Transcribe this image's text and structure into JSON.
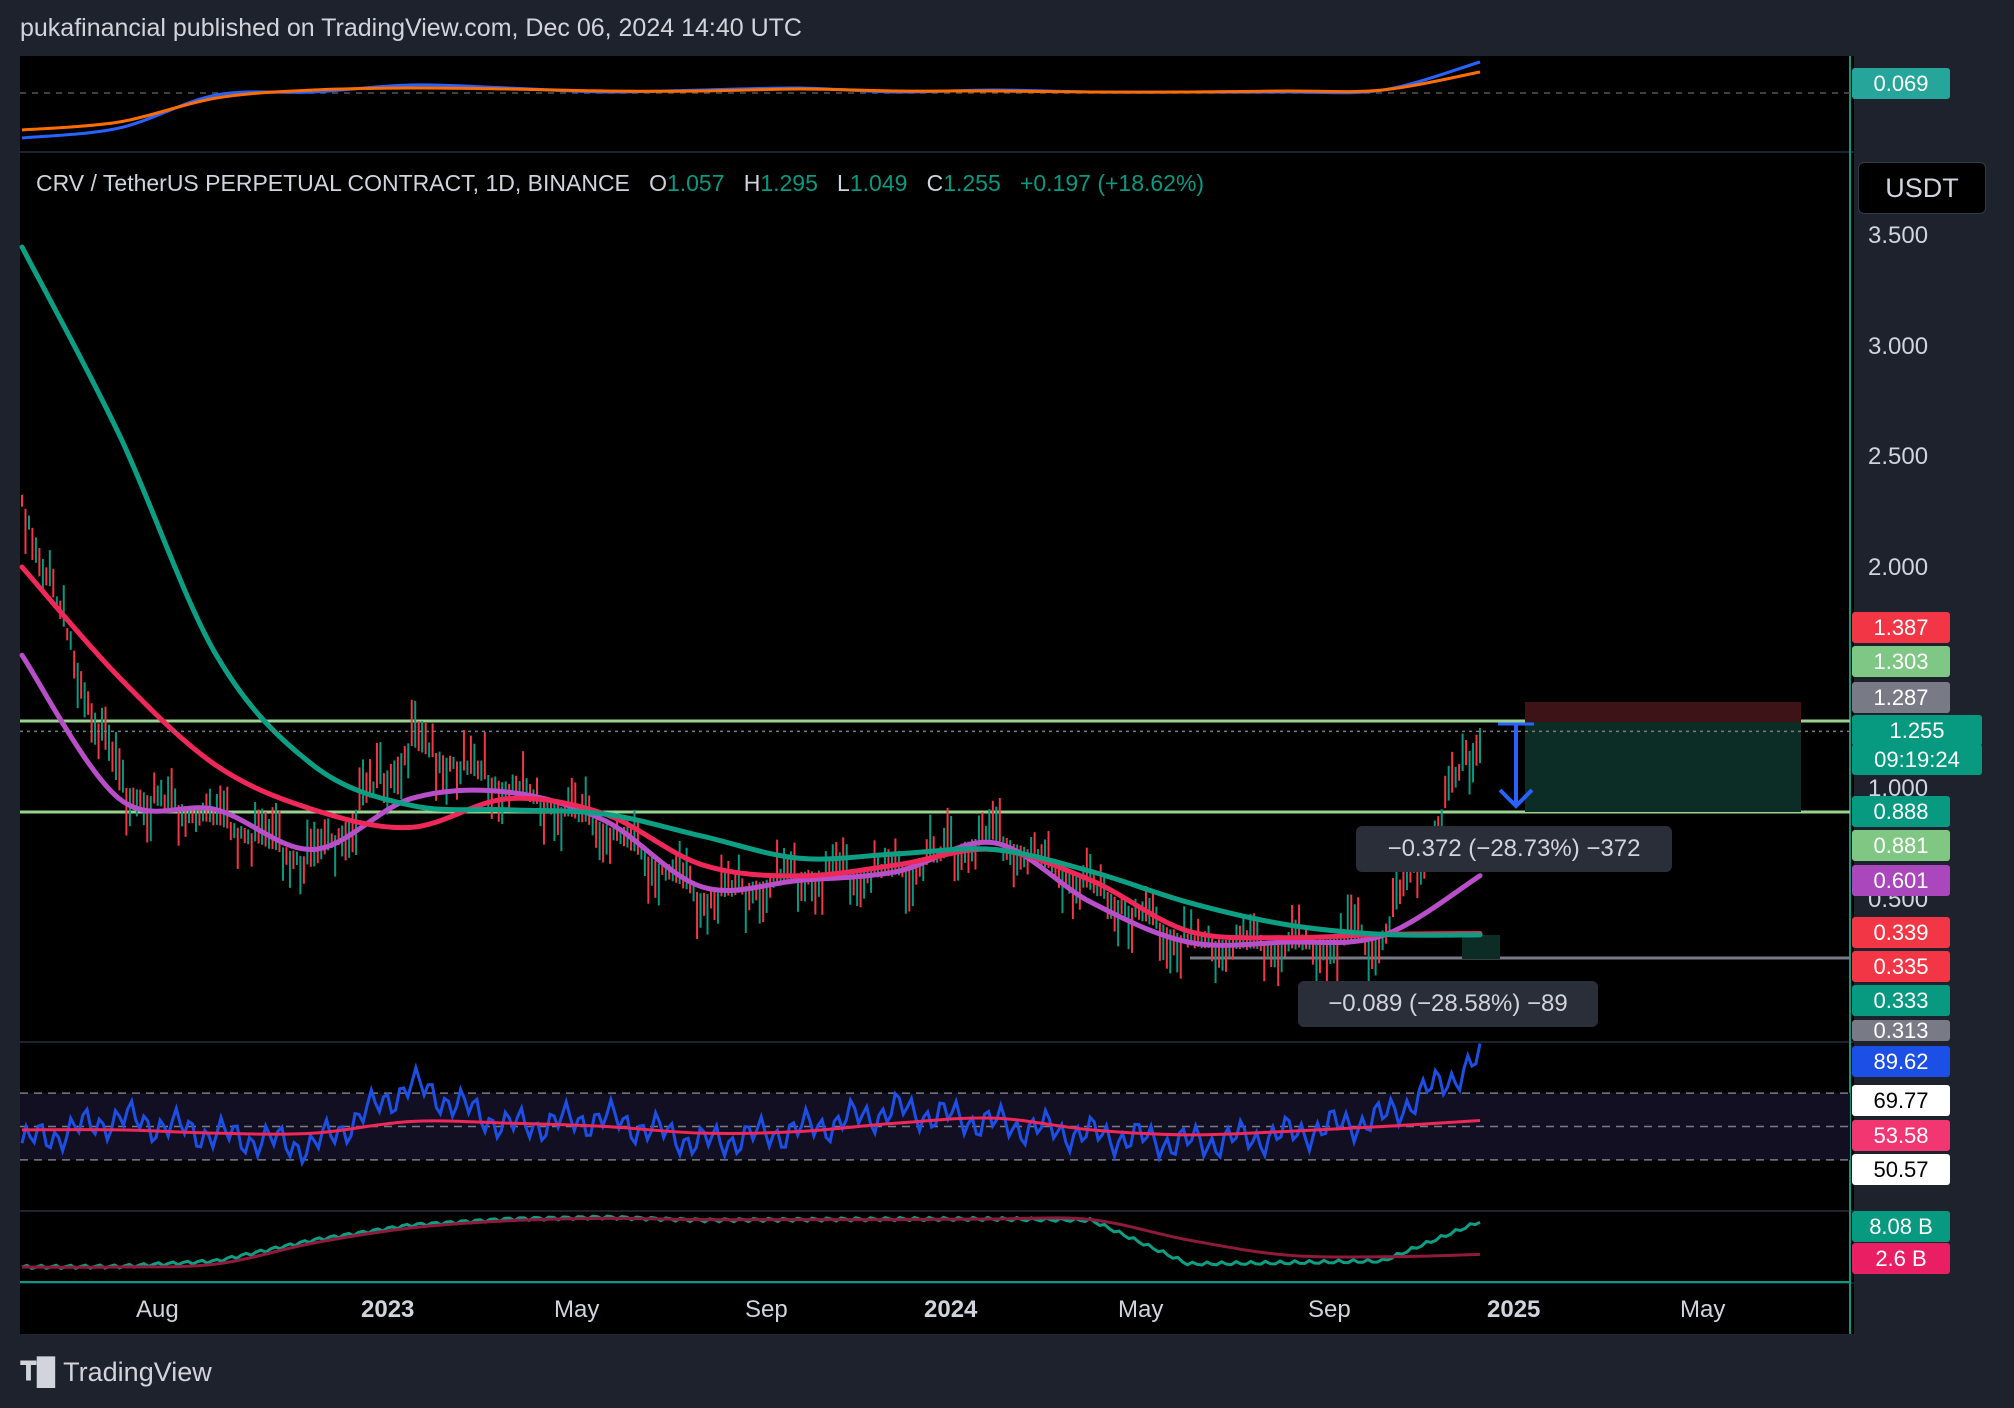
{
  "header": {
    "published": "pukafinancial published on TradingView.com, Dec 06, 2024 14:40 UTC"
  },
  "symbol": {
    "name": "CRV / TetherUS PERPETUAL CONTRACT, 1D, BINANCE",
    "o_label": "O",
    "o": "1.057",
    "h_label": "H",
    "h": "1.295",
    "l_label": "L",
    "l": "1.049",
    "c_label": "C",
    "c": "1.255",
    "change": "+0.197 (+18.62%)"
  },
  "currency": "USDT",
  "colors": {
    "up": "#089981",
    "down": "#f23645",
    "ema_slow": "#0d9f84",
    "ema_mid": "#f0285a",
    "ema_fast": "#b84fc9",
    "rsi": "#1c4fe6",
    "level": "#9ad38f"
  },
  "price_axis": {
    "ticks": [
      "3.500",
      "3.000",
      "2.500",
      "2.000",
      "1.000",
      "0.500"
    ]
  },
  "price_labels": [
    {
      "text": "1.387",
      "bg": "#f23645"
    },
    {
      "text": "1.303",
      "bg": "#7fc784"
    },
    {
      "text": "1.287",
      "bg": "#787b86"
    },
    {
      "text": "1.255",
      "bg": "#089981"
    },
    {
      "text": "09:19:24",
      "bg": "#089981"
    },
    {
      "text": "0.888",
      "bg": "#089981"
    },
    {
      "text": "0.881",
      "bg": "#81c784"
    },
    {
      "text": "0.601",
      "bg": "#ab47bc"
    },
    {
      "text": "0.339",
      "bg": "#f23645"
    },
    {
      "text": "0.335",
      "bg": "#f23645"
    },
    {
      "text": "0.333",
      "bg": "#089981"
    },
    {
      "text": "0.313",
      "bg": "#787b86"
    }
  ],
  "top_indicator": {
    "value": "0.069"
  },
  "rsi_panel": {
    "labels": [
      "89.62",
      "69.77",
      "53.58",
      "50.57"
    ]
  },
  "volume_panel": {
    "labels": [
      "8.08 B",
      "2.6 B"
    ]
  },
  "measurements": [
    "−0.372 (−28.73%) −372",
    "−0.089 (−28.58%) −89"
  ],
  "time_axis": [
    {
      "label": "Aug",
      "bold": false
    },
    {
      "label": "2023",
      "bold": true
    },
    {
      "label": "May",
      "bold": false
    },
    {
      "label": "Sep",
      "bold": false
    },
    {
      "label": "2024",
      "bold": true
    },
    {
      "label": "May",
      "bold": false
    },
    {
      "label": "Sep",
      "bold": false
    },
    {
      "label": "2025",
      "bold": true
    },
    {
      "label": "May",
      "bold": false
    }
  ],
  "footer": {
    "brand": "TradingView"
  },
  "chart_data": {
    "type": "line",
    "title": "CRV / TetherUS PERPETUAL CONTRACT, 1D, BINANCE",
    "ylim": [
      0.2,
      3.7
    ],
    "x": [
      "2022-06",
      "2022-08",
      "2022-10",
      "2023-01",
      "2023-03",
      "2023-05",
      "2023-07",
      "2023-09",
      "2023-11",
      "2024-01",
      "2024-03",
      "2024-05",
      "2024-07",
      "2024-09",
      "2024-11",
      "2024-12"
    ],
    "series": [
      {
        "values": [
          2.3,
          1.0,
          0.85,
          0.65,
          1.2,
          1.0,
          0.82,
          0.5,
          0.6,
          0.62,
          0.78,
          0.55,
          0.3,
          0.28,
          0.33,
          1.255
        ]
      },
      {
        "values": [
          1.6,
          0.95,
          0.9,
          0.72,
          0.95,
          0.98,
          0.85,
          0.55,
          0.58,
          0.62,
          0.75,
          0.48,
          0.3,
          0.3,
          0.33,
          0.601
        ]
      },
      {
        "values": [
          2.0,
          1.5,
          1.1,
          0.9,
          0.82,
          0.95,
          0.88,
          0.65,
          0.6,
          0.65,
          0.72,
          0.58,
          0.35,
          0.32,
          0.335,
          0.339
        ]
      },
      {
        "values": [
          3.45,
          2.6,
          1.6,
          1.1,
          0.92,
          0.9,
          0.88,
          0.78,
          0.68,
          0.7,
          0.72,
          0.62,
          0.48,
          0.38,
          0.335,
          0.333
        ]
      }
    ],
    "levels": [
      1.287,
      0.888,
      0.313
    ],
    "rsi": {
      "values": [
        40,
        55,
        45,
        38,
        75,
        50,
        55,
        40,
        48,
        60,
        52,
        45,
        40,
        45,
        55,
        89.62
      ],
      "ma": [
        48,
        48,
        46,
        46,
        53,
        52,
        50,
        46,
        47,
        52,
        55,
        48,
        45,
        47,
        50,
        53.58
      ],
      "bands": [
        70,
        50,
        30
      ]
    },
    "volume": {
      "obv": [
        0.5,
        0.6,
        1.5,
        5.0,
        7.5,
        8.5,
        8.8,
        8.3,
        8.4,
        8.5,
        8.5,
        8.3,
        1.0,
        1.2,
        1.5,
        8.08
      ],
      "ma": [
        0.5,
        0.5,
        1.0,
        4.5,
        7.0,
        8.2,
        8.6,
        8.4,
        8.4,
        8.4,
        8.5,
        8.4,
        5.0,
        2.5,
        2.2,
        2.6
      ]
    }
  }
}
